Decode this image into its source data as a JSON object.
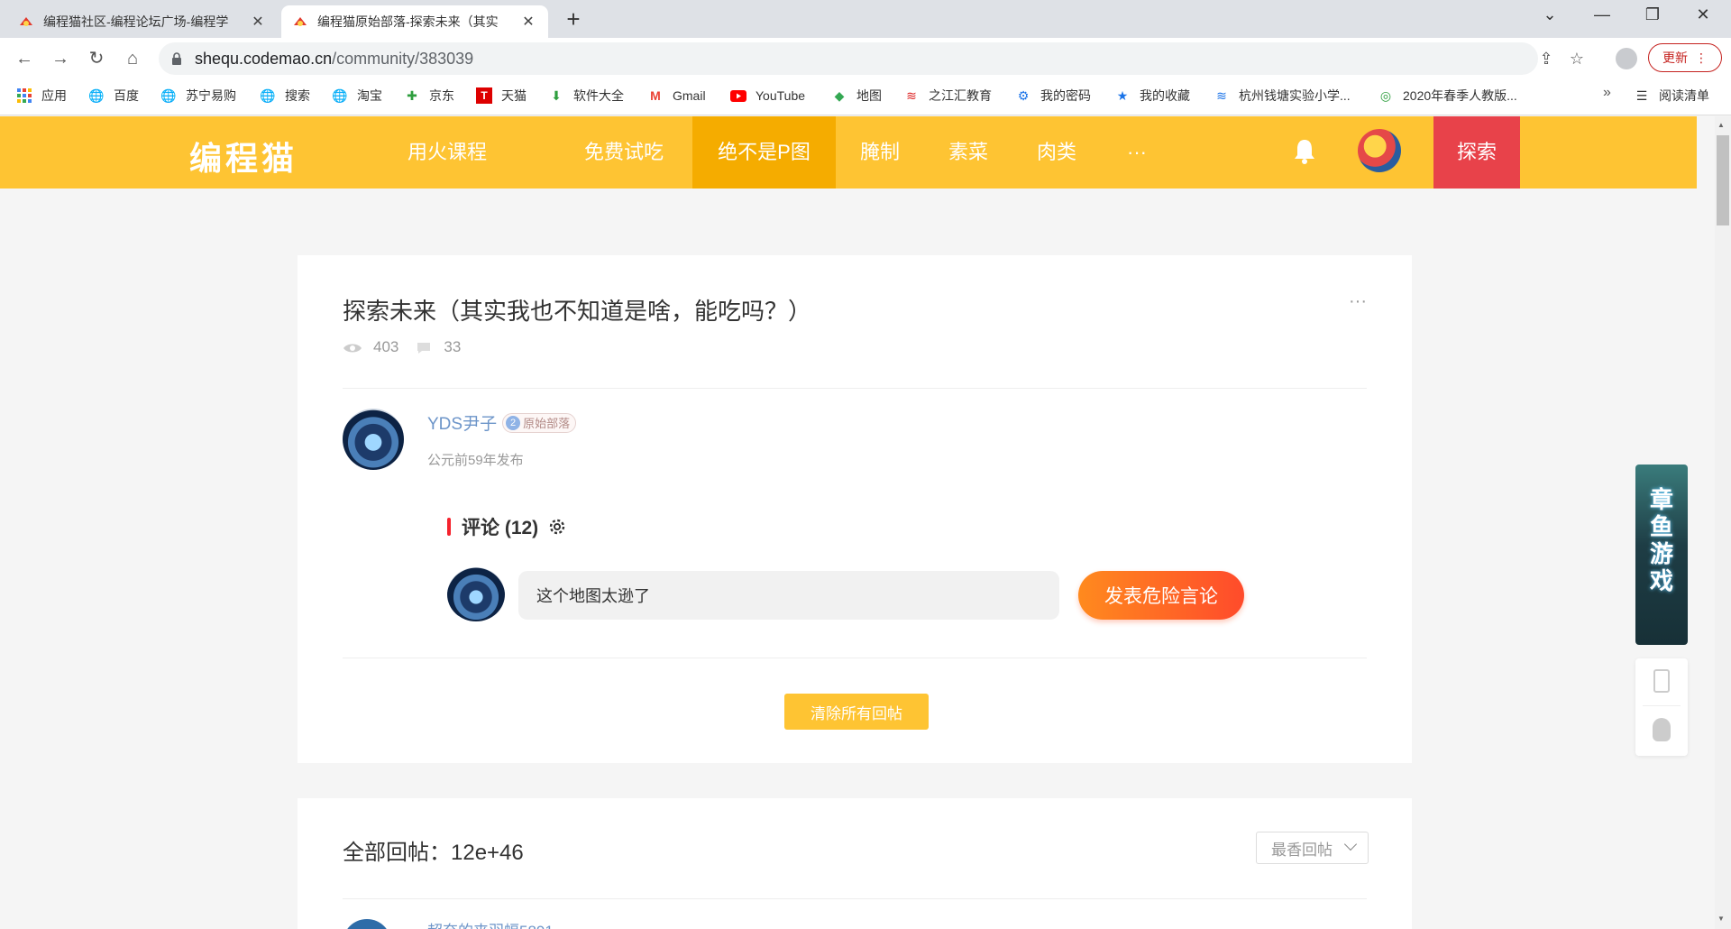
{
  "browser": {
    "tabs": [
      {
        "title": "编程猫社区-编程论坛广场-编程学",
        "active": false
      },
      {
        "title": "编程猫原始部落-探索未来（其实",
        "active": true
      }
    ],
    "new_tab": "+",
    "url_host": "shequ.codemao.cn",
    "url_path": "/community/383039",
    "update_label": "更新",
    "bookmarks": [
      {
        "label": "应用",
        "icon": "apps-grid-icon"
      },
      {
        "label": "百度",
        "icon": "globe-icon"
      },
      {
        "label": "苏宁易购",
        "icon": "globe-icon"
      },
      {
        "label": "搜索",
        "icon": "globe-icon"
      },
      {
        "label": "淘宝",
        "icon": "globe-icon"
      },
      {
        "label": "京东",
        "icon": "jd-icon"
      },
      {
        "label": "天猫",
        "icon": "tmall-icon"
      },
      {
        "label": "软件大全",
        "icon": "download-icon"
      },
      {
        "label": "Gmail",
        "icon": "gmail-icon"
      },
      {
        "label": "YouTube",
        "icon": "youtube-icon"
      },
      {
        "label": "地图",
        "icon": "maps-icon"
      },
      {
        "label": "之江汇教育",
        "icon": "zjh-icon"
      },
      {
        "label": "我的密码",
        "icon": "gear-icon"
      },
      {
        "label": "我的收藏",
        "icon": "star-icon"
      },
      {
        "label": "杭州钱塘实验小学...",
        "icon": "school-icon"
      },
      {
        "label": "2020年春季人教版...",
        "icon": "book-icon"
      }
    ],
    "more_bookmarks": "»",
    "reading_list": "阅读清单"
  },
  "site_nav": {
    "logo": "编程猫",
    "links": [
      "用火课程",
      "免费试吃",
      "绝不是P图",
      "腌制",
      "素菜",
      "肉类",
      "···"
    ],
    "active_index": 2,
    "explore": "探索"
  },
  "post": {
    "title": "探索未来（其实我也不知道是啥，能吃吗？）",
    "more": "···",
    "views": "403",
    "comments": "33",
    "author": "YDS尹子",
    "badge_num": "2",
    "badge_label": "原始部落",
    "date": "公元前59年发布",
    "comment_heading": "评论 (12)",
    "comment_input_value": "这个地图太逊了",
    "post_button": "发表危险言论",
    "clear_button": "清除所有回帖"
  },
  "replies": {
    "title": "全部回帖：12e+46",
    "sort_label": "最香回帖",
    "first_reply_author": "超奈的夹羽蝠5891"
  },
  "side_ad": {
    "text": "章鱼游戏"
  },
  "colors": {
    "nav_bg": "#fec433",
    "nav_active": "#f5ac00",
    "explore_bg": "#e8424a",
    "author_name": "#6d95c9",
    "post_button_from": "#ff8a1e",
    "post_button_to": "#ff4b2b"
  }
}
